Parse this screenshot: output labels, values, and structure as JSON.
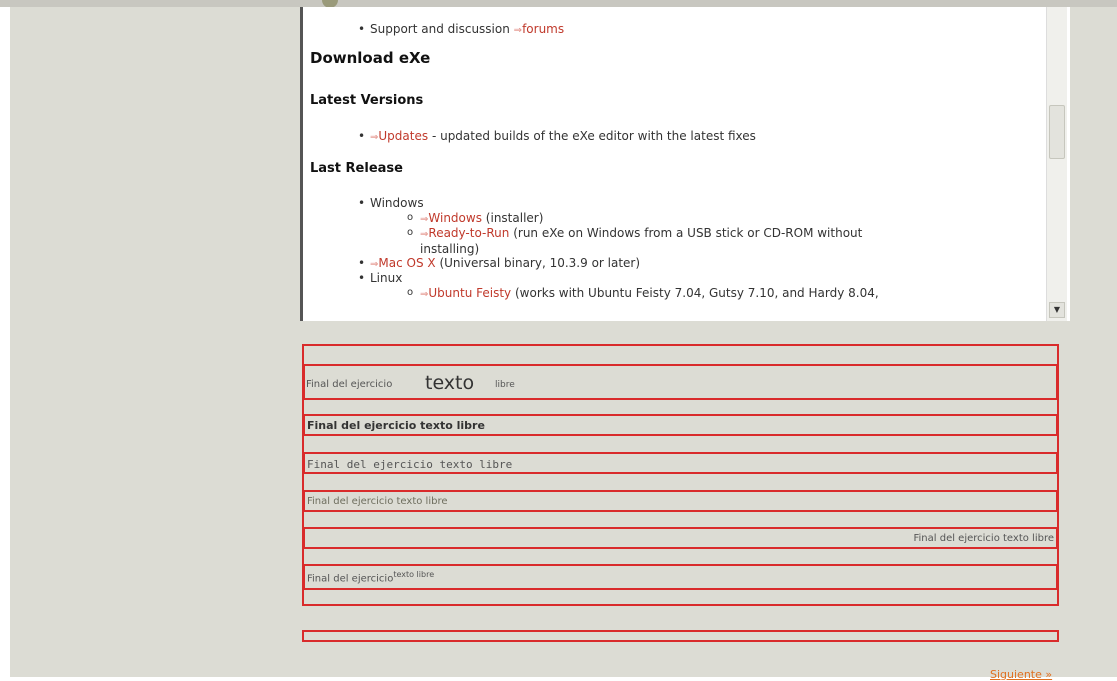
{
  "doc": {
    "support_text": "Support and discussion",
    "support_link": "forums",
    "arrow": "⇒",
    "download_heading": "Download eXe",
    "latest_heading": "Latest Versions",
    "updates_link": "Updates",
    "updates_desc": "- updated builds of the eXe editor with the latest fixes",
    "last_release_heading": "Last Release",
    "windows_label": "Windows",
    "win_link": "Windows",
    "win_desc": "(installer)",
    "rtr_link": "Ready-to-Run",
    "rtr_desc": "(run eXe on Windows from a USB stick or CD-ROM without",
    "rtr_desc2": "installing)",
    "mac_link": "Mac OS X",
    "mac_desc": "(Universal binary, 10.3.9 or later)",
    "linux_label": "Linux",
    "ubuntu_link": "Ubuntu Feisty",
    "ubuntu_desc": "(works with Ubuntu Feisty 7.04, Gutsy 7.10, and Hardy 8.04,"
  },
  "exercise": {
    "r1_small": "Final del ejercicio",
    "r1_big": "texto",
    "r1_small2": "libre",
    "r2": "Final del ejercicio texto libre",
    "r3": "Final del ejercicio texto libre",
    "r4": "Final del ejercicio texto libre",
    "r5": "Final del ejercicio texto libre",
    "r6_main": "Final del ejercicio",
    "r6_sup": "texto libre"
  },
  "nav": {
    "next_label": "Siguiente »"
  },
  "colors": {
    "border": "#d92b2b",
    "link": "#c0392b",
    "background": "#dcdcd4"
  }
}
